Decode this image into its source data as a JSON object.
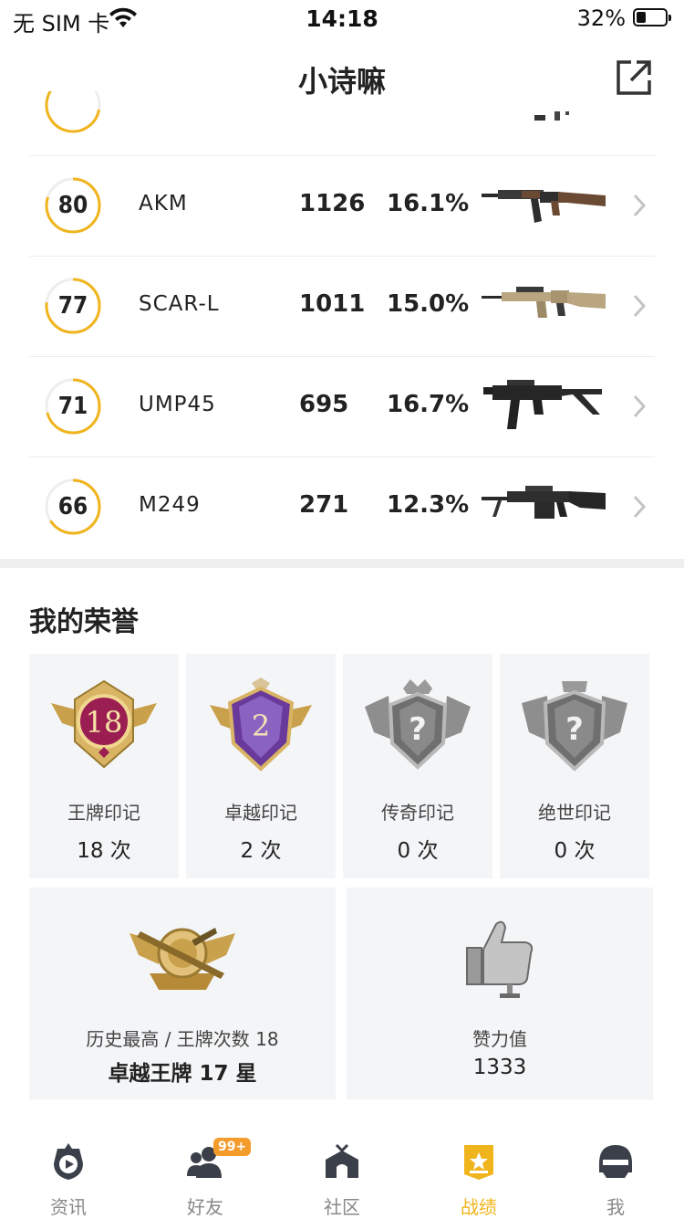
{
  "status_bar": {
    "carrier": "无 SIM 卡",
    "time": "14:18",
    "battery": "32%",
    "battery_level": 0.32
  },
  "header": {
    "title": "小诗嘛",
    "share_icon": "share-external-icon"
  },
  "weapons": [
    {
      "score": "80",
      "score_level": 0.8,
      "name": "AKM",
      "kills": "1126",
      "rate": "16.1%",
      "gun_icon": "akm-rifle-icon"
    },
    {
      "score": "77",
      "score_level": 0.77,
      "name": "SCAR-L",
      "kills": "1011",
      "rate": "15.0%",
      "gun_icon": "scar-l-rifle-icon"
    },
    {
      "score": "71",
      "score_level": 0.71,
      "name": "UMP45",
      "kills": "695",
      "rate": "16.7%",
      "gun_icon": "ump45-smg-icon"
    },
    {
      "score": "66",
      "score_level": 0.66,
      "name": "M249",
      "kills": "271",
      "rate": "12.3%",
      "gun_icon": "m249-lmg-icon"
    }
  ],
  "honor": {
    "title": "我的荣誉",
    "badges": [
      {
        "label": "王牌印记",
        "count": "18 次",
        "emblem_text": "18",
        "icon": "ace-mark-icon"
      },
      {
        "label": "卓越印记",
        "count": "2 次",
        "emblem_text": "2",
        "icon": "excellence-mark-icon"
      },
      {
        "label": "传奇印记",
        "count": "0 次",
        "emblem_text": "?",
        "icon": "legend-mark-icon"
      },
      {
        "label": "绝世印记",
        "count": "0 次",
        "emblem_text": "?",
        "icon": "peerless-mark-icon"
      }
    ],
    "highest": {
      "label": "历史最高 / 王牌次数 18",
      "value": "卓越王牌 17 星",
      "icon": "rank-emblem-icon"
    },
    "likes": {
      "label": "赞力值",
      "value": "1333",
      "icon": "thumbs-up-trophy-icon"
    }
  },
  "tabs": [
    {
      "label": "资讯",
      "icon": "news-icon",
      "active": false
    },
    {
      "label": "好友",
      "icon": "friends-icon",
      "badge": "99+",
      "active": false
    },
    {
      "label": "社区",
      "icon": "community-icon",
      "active": false
    },
    {
      "label": "战绩",
      "icon": "record-icon",
      "active": true
    },
    {
      "label": "我",
      "icon": "profile-helmet-icon",
      "active": false
    }
  ],
  "colors": {
    "accent": "#f0b41c",
    "ring_track": "#eeeeee",
    "card_bg": "#f4f5f7"
  }
}
